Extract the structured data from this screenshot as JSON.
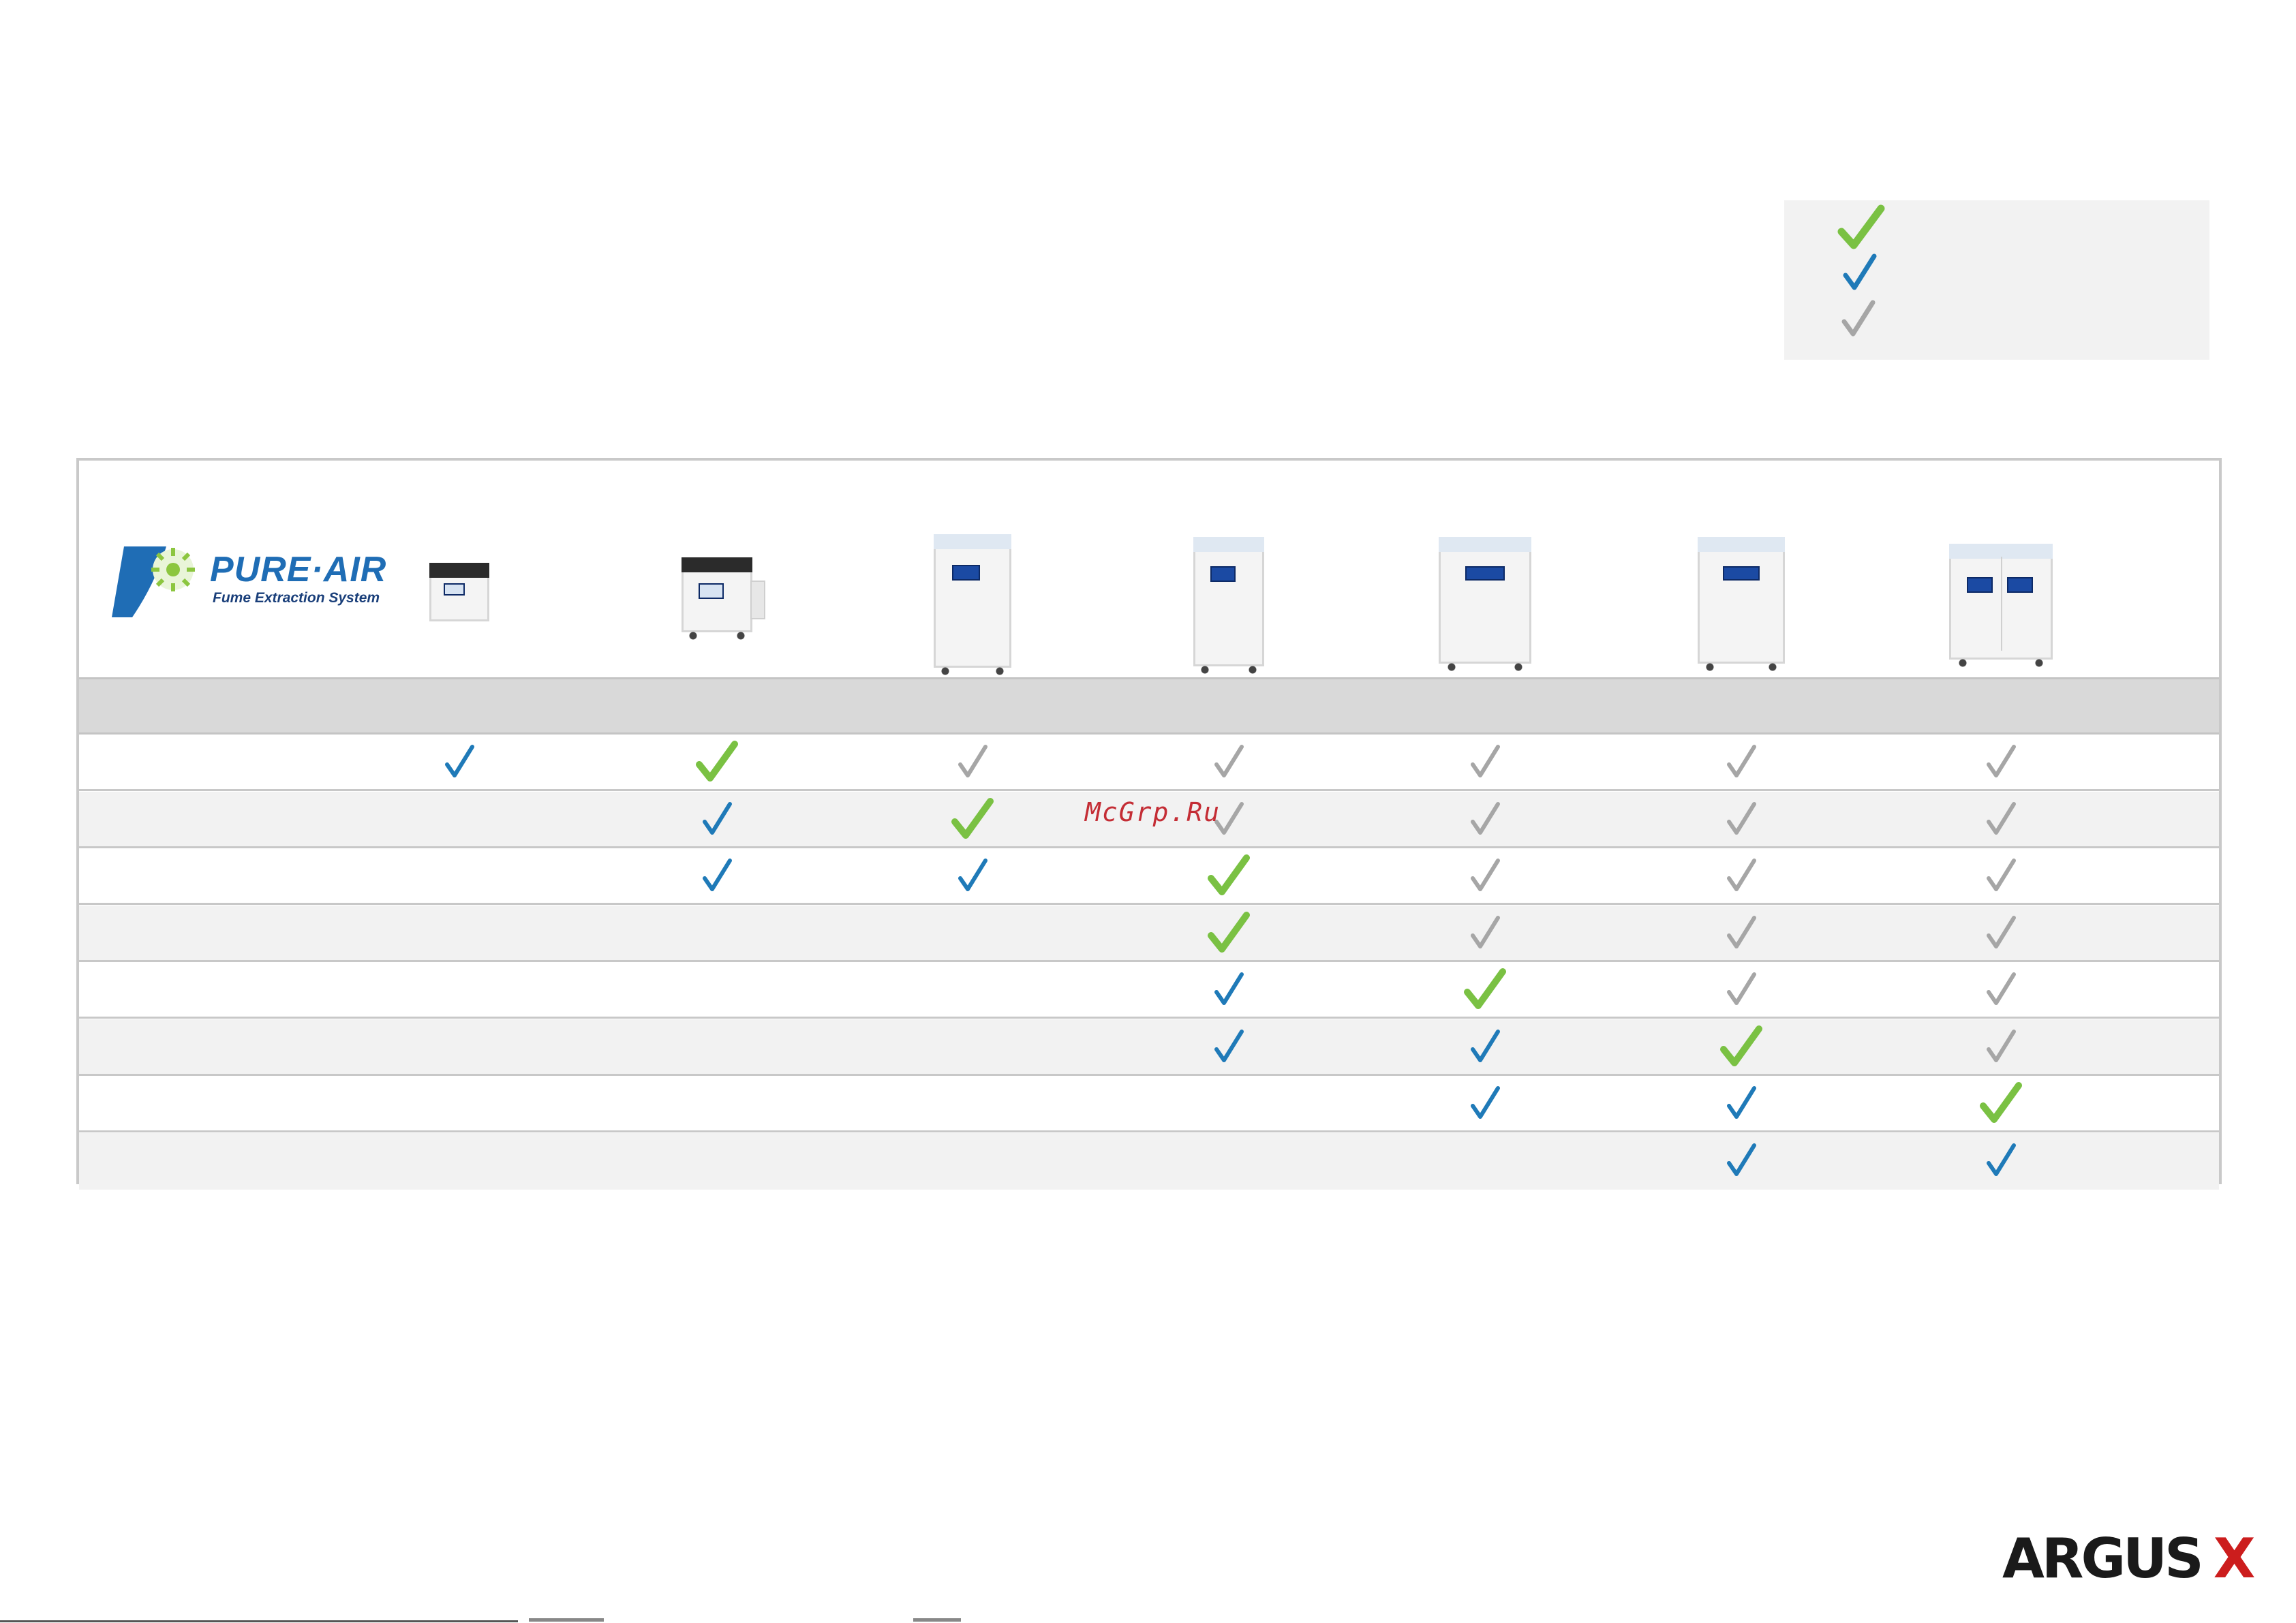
{
  "legend": {
    "items": [
      {
        "icon": "large-green-check-icon",
        "color": "#7ac143"
      },
      {
        "icon": "blue-check-icon",
        "color": "#1f7ab8"
      },
      {
        "icon": "gray-check-icon",
        "color": "#a6a6a6"
      }
    ]
  },
  "brand": {
    "name": "PURE·AIR",
    "subtitle": "Fume Extraction System",
    "colors": {
      "primary": "#1f6db5",
      "accent": "#8cc63f"
    }
  },
  "check_colors": {
    "green": "#7ac143",
    "blue": "#1f7ab8",
    "gray": "#a6a6a6"
  },
  "products": [
    {
      "icon": "compact-extractor-unit-icon"
    },
    {
      "icon": "benchtop-extractor-with-filter-icon"
    },
    {
      "icon": "tall-cabinet-extractor-icon"
    },
    {
      "icon": "tall-cabinet-extractor-icon"
    },
    {
      "icon": "large-cabinet-extractor-icon"
    },
    {
      "icon": "large-cabinet-extractor-icon"
    },
    {
      "icon": "double-cabinet-extractor-icon"
    }
  ],
  "matrix": [
    [
      "blue",
      "green",
      "gray",
      "gray",
      "gray",
      "gray",
      "gray"
    ],
    [
      "",
      "blue",
      "green",
      "gray",
      "gray",
      "gray",
      "gray"
    ],
    [
      "",
      "blue",
      "blue",
      "green",
      "gray",
      "gray",
      "gray"
    ],
    [
      "",
      "",
      "",
      "green",
      "gray",
      "gray",
      "gray"
    ],
    [
      "",
      "",
      "",
      "blue",
      "green",
      "gray",
      "gray"
    ],
    [
      "",
      "",
      "",
      "blue",
      "blue",
      "green",
      "gray"
    ],
    [
      "",
      "",
      "",
      "",
      "blue",
      "blue",
      "green"
    ],
    [
      "",
      "",
      "",
      "",
      "",
      "blue",
      "blue"
    ]
  ],
  "watermark": "McGrp.Ru",
  "footer": {
    "brand_main": "ARGUS",
    "brand_x": "X",
    "brand_x_color": "#cc1d1d"
  }
}
